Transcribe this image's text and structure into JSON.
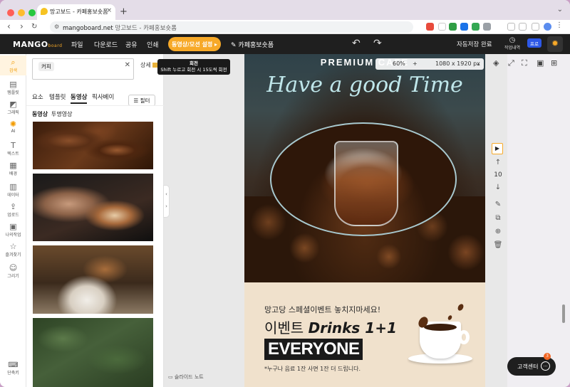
{
  "browser": {
    "tab_title": "망고보드 - 카페홍보숏폼",
    "url_host": "mangoboard.net",
    "url_title": "망고보드 - 카페홍보숏폼"
  },
  "header": {
    "logo_main": "MANGO",
    "logo_sub": "board",
    "menu": [
      "파일",
      "다운로드",
      "공유",
      "인쇄"
    ],
    "video_settings": "동영상/모션 설정",
    "project_name": "카페홍보숏폼",
    "autosave": "자동저장 완료",
    "history_label": "작업내역",
    "pro_badge": "프로"
  },
  "tooltip": {
    "title": "회전",
    "text": "Shift 누르고 회전 시 15도씩 회전"
  },
  "rail": [
    {
      "label": "검색",
      "icon": "search-icon"
    },
    {
      "label": "템플릿",
      "icon": "template-icon"
    },
    {
      "label": "그래픽",
      "icon": "graphic-icon"
    },
    {
      "label": "AI",
      "icon": "ai-icon"
    },
    {
      "label": "텍스트",
      "icon": "text-icon"
    },
    {
      "label": "배경",
      "icon": "background-icon"
    },
    {
      "label": "데이터",
      "icon": "data-icon"
    },
    {
      "label": "업로드",
      "icon": "upload-icon"
    },
    {
      "label": "나의작업",
      "icon": "my-work-icon"
    },
    {
      "label": "즐겨찾기",
      "icon": "star-icon"
    },
    {
      "label": "그리기",
      "icon": "draw-icon"
    }
  ],
  "rail_shortcut": "단축키",
  "panel": {
    "search_chip": "커피",
    "detail_label": "상세",
    "tabs": [
      "요소",
      "템플릿",
      "동영상",
      "픽사베이"
    ],
    "filter_label": "필터",
    "subtabs": [
      "동영상",
      "투명영상"
    ]
  },
  "canvas": {
    "zoom": "60%",
    "size": "1080 x 1920 px",
    "headline": "PREMIUM CAFE",
    "script": "Have a good Time",
    "promo_line1": "망고당 스페셜이벤트 놓치지마세요!",
    "promo_line2_prefix": "이벤트 ",
    "promo_line2_bold": "Drinks 1+1",
    "promo_everyone": "EVERYONE",
    "promo_note": "*누구나 음료 1잔 사면 1잔 더 드립니다.",
    "slide_note": "슬라이드 노트"
  },
  "right_toolbar": {
    "page_number": "10"
  },
  "support": {
    "label": "고객센터",
    "badge": "3"
  },
  "colors": {
    "accent": "#f7a928",
    "header_bg": "#1f1f1f",
    "pro": "#2d58e8"
  }
}
